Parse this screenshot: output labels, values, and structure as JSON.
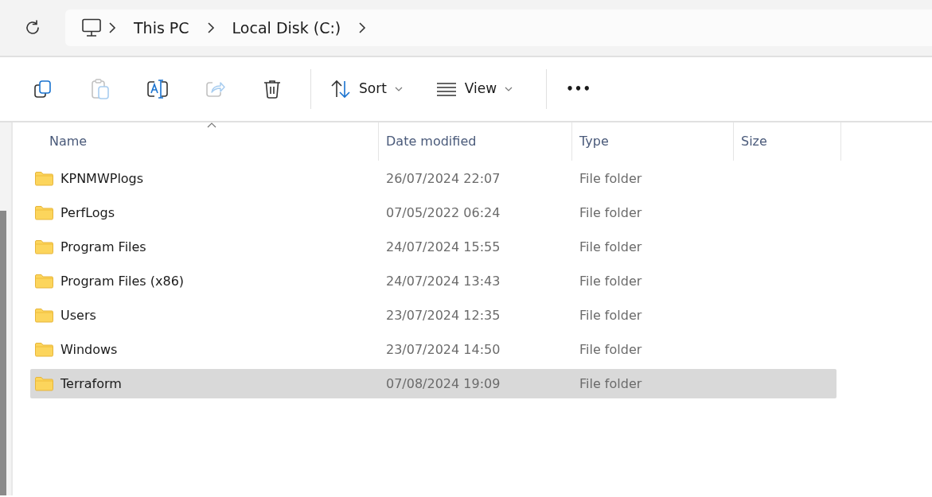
{
  "address_bar": {
    "crumbs": [
      "This PC",
      "Local Disk (C:)"
    ]
  },
  "toolbar": {
    "icon_buttons": [
      {
        "disabled": false
      },
      {
        "disabled": true
      },
      {
        "disabled": false
      },
      {
        "disabled": true
      },
      {
        "disabled": false
      }
    ],
    "menus": [
      {
        "label": "Sort"
      },
      {
        "label": "View"
      }
    ],
    "more": {
      "label": "•••"
    }
  },
  "file_list": {
    "columns": [
      {
        "label": "Name",
        "sorted": true
      },
      {
        "label": "Date modified",
        "sorted": false
      },
      {
        "label": "Type",
        "sorted": false
      },
      {
        "label": "Size",
        "sorted": false
      }
    ],
    "rows": [
      {
        "name": "KPNMWPlogs",
        "date": "26/07/2024 22:07",
        "type": "File folder",
        "selected": false
      },
      {
        "name": "PerfLogs",
        "date": "07/05/2022 06:24",
        "type": "File folder",
        "selected": false
      },
      {
        "name": "Program Files",
        "date": "24/07/2024 15:55",
        "type": "File folder",
        "selected": false
      },
      {
        "name": "Program Files (x86)",
        "date": "24/07/2024 13:43",
        "type": "File folder",
        "selected": false
      },
      {
        "name": "Users",
        "date": "23/07/2024 12:35",
        "type": "File folder",
        "selected": false
      },
      {
        "name": "Windows",
        "date": "23/07/2024 14:50",
        "type": "File folder",
        "selected": false
      },
      {
        "name": "Terraform",
        "date": "07/08/2024 19:09",
        "type": "File folder",
        "selected": true
      }
    ]
  }
}
